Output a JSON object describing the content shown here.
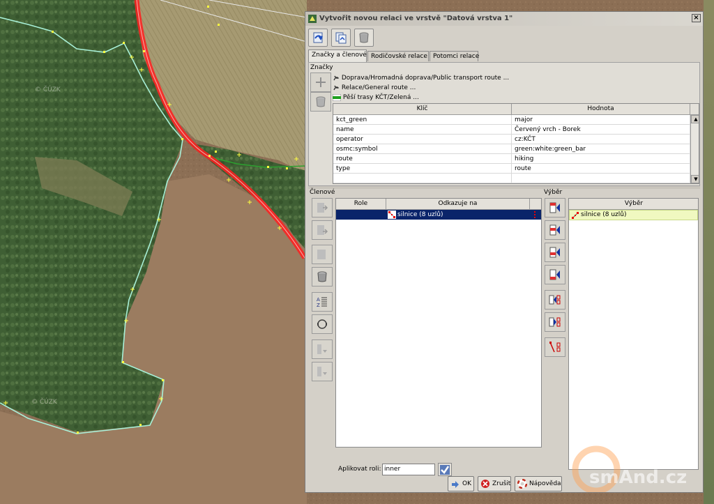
{
  "map": {
    "watermark_1": "© ČÚZK",
    "watermark_2": "© ČÚZK"
  },
  "dialog": {
    "title": "Vytvořit novou relaci ve vrstvě \"Datová vrstva 1\"",
    "close": "×",
    "tabs": [
      {
        "label": "Značky a členové"
      },
      {
        "label": "Rodičovské relace"
      },
      {
        "label": "Potomci relace"
      }
    ],
    "tags_section": {
      "label": "Značky",
      "presets": [
        {
          "label": "Doprava/Hromadná doprava/Public transport route ..."
        },
        {
          "label": "Relace/General route ..."
        },
        {
          "label": "Pěší trasy KČT/Zelená ..."
        }
      ],
      "columns": {
        "key": "Klíč",
        "value": "Hodnota"
      },
      "rows": [
        {
          "key": "kct_green",
          "value": "major"
        },
        {
          "key": "name",
          "value": "Červený vrch - Borek"
        },
        {
          "key": "operator",
          "value": "cz:KČT"
        },
        {
          "key": "osmc:symbol",
          "value": "green:white:green_bar"
        },
        {
          "key": "route",
          "value": "hiking"
        },
        {
          "key": "type",
          "value": "route"
        }
      ]
    },
    "members_section": {
      "label": "Členové",
      "columns": {
        "role": "Role",
        "refers": "Odkazuje na"
      },
      "rows": [
        {
          "role": "",
          "refers": "silnice (8 uzlů)"
        }
      ],
      "apply_role_label": "Aplikovat roli:",
      "apply_role_value": "inner"
    },
    "selection_section": {
      "label": "Výběr",
      "column": "Výběr",
      "rows": [
        {
          "label": "silnice (8 uzlů)"
        }
      ]
    },
    "buttons": {
      "ok": "OK",
      "cancel": "Zrušit",
      "help": "Nápověda"
    }
  },
  "watermark_brand": "smAnd.cz",
  "colors": {
    "accent_selected": "#0a246a",
    "selection_row": "#f0f8c0",
    "route_red": "#e01818",
    "area_outline": "#9fe8d0"
  }
}
